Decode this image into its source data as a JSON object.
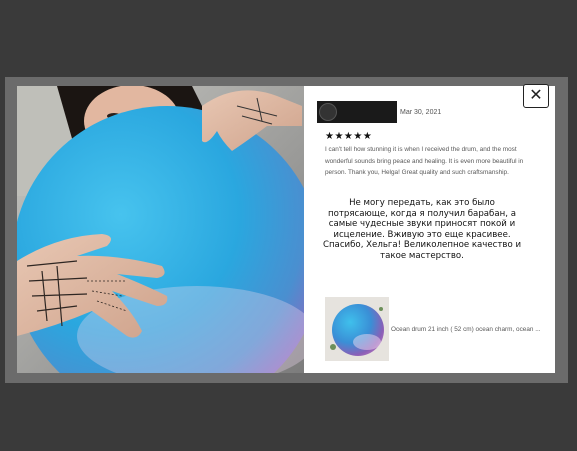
{
  "review": {
    "date": "Mar 30, 2021",
    "rating": 5,
    "stars_text": "★★★★★",
    "text": "I can't tell how stunning it is when I received the drum, and the most wonderful sounds bring peace and healing. It is even more beautiful in person. Thank you, Helga! Great quality and such craftsmanship.",
    "translation": "Не могу передать, как это было потрясающе, когда я получил барабан, а самые чудесные звуки приносят покой и исцеление. Вживую это еще красивее. Спасибо, Хельга! Великолепное качество и такое мастерство."
  },
  "listing": {
    "title": "Ocean drum 21 inch ( 52 cm) ocean charm, ocean ..."
  },
  "controls": {
    "close_glyph": "✕"
  },
  "icons": {
    "close": "close-icon",
    "avatar": "user-avatar"
  },
  "colors": {
    "backdrop": "#3a3a3a",
    "frame": "#6b6b6b",
    "drum_blue": "#29a6dd",
    "drum_purple": "#8a5fb7"
  }
}
